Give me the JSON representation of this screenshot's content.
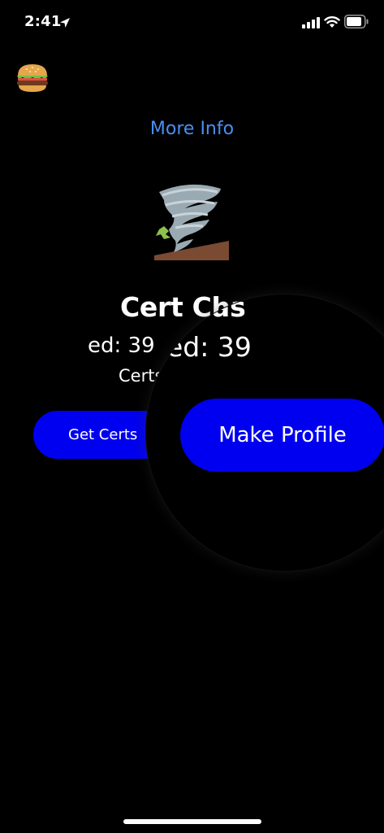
{
  "status_bar": {
    "time": "2:41"
  },
  "header": {
    "more_info_label": "More Info"
  },
  "main": {
    "title": "Cert Chas",
    "count_text": "ed: 39",
    "sub_text": "Certs",
    "get_certs_label": "Get Certs"
  },
  "magnifier": {
    "title_text": "Cert Chas",
    "count_text": "ed: 39",
    "make_profile_label": "Make Profile"
  },
  "colors": {
    "background": "#000000",
    "link": "#4a8ef3",
    "button": "#0000f0"
  },
  "icons": {
    "menu": "burger-icon",
    "app_logo": "tornado-icon"
  }
}
